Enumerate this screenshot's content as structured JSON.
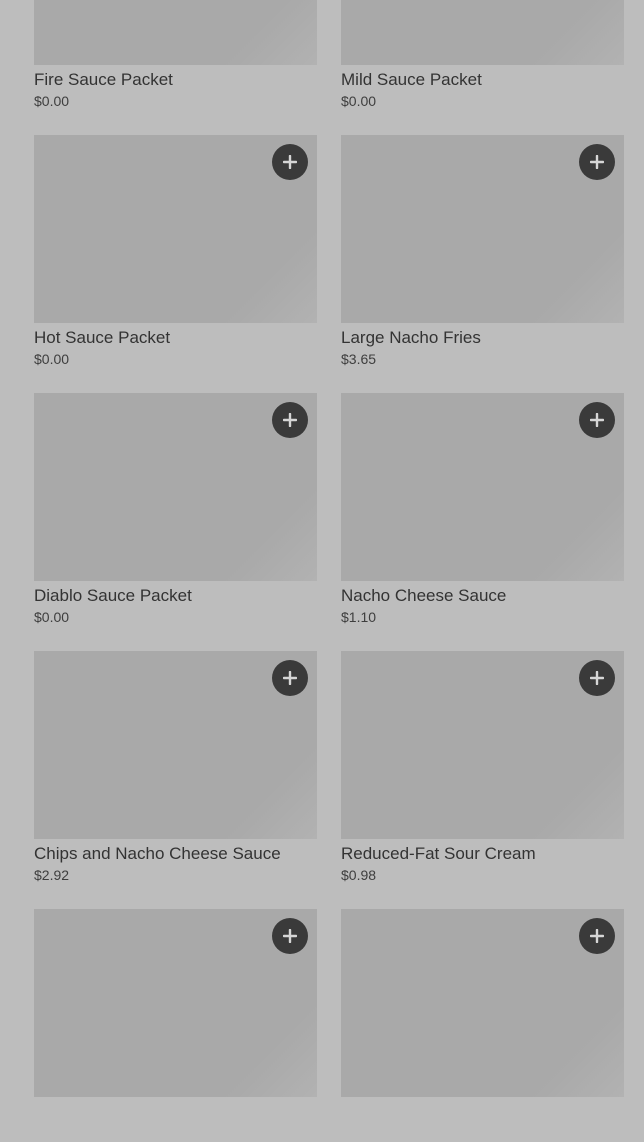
{
  "icons": {
    "add": "plus-icon"
  },
  "colors": {
    "page_background": "#bdbdbd",
    "image_placeholder": "#a9a9a9",
    "add_button": "#3a3a3a"
  },
  "menu": {
    "items": [
      {
        "name": "Fire Sauce Packet",
        "price": "$0.00"
      },
      {
        "name": "Mild Sauce Packet",
        "price": "$0.00"
      },
      {
        "name": "Hot Sauce Packet",
        "price": "$0.00"
      },
      {
        "name": "Large Nacho Fries",
        "price": "$3.65"
      },
      {
        "name": "Diablo Sauce Packet",
        "price": "$0.00"
      },
      {
        "name": "Nacho Cheese Sauce",
        "price": "$1.10"
      },
      {
        "name": "Chips and Nacho Cheese Sauce",
        "price": "$2.92"
      },
      {
        "name": "Reduced-Fat Sour Cream",
        "price": "$0.98"
      },
      {
        "name": "",
        "price": ""
      },
      {
        "name": "",
        "price": ""
      }
    ]
  }
}
